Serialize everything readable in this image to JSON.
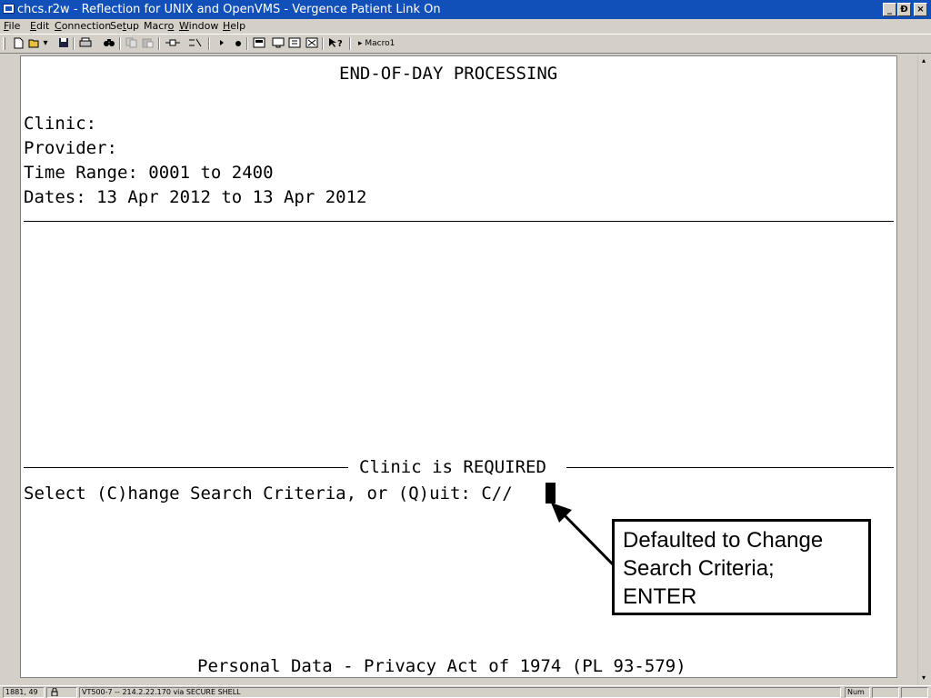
{
  "window": {
    "title": "chcs.r2w - Reflection for UNIX and OpenVMS - Vergence Patient Link On",
    "minimize": "_",
    "restore": "Ɖ",
    "close": "×"
  },
  "menu": [
    {
      "prefix": "",
      "ul": "F",
      "suffix": "ile"
    },
    {
      "prefix": "",
      "ul": "E",
      "suffix": "dit"
    },
    {
      "prefix": "",
      "ul": "C",
      "suffix": "onnection"
    },
    {
      "prefix": "Se",
      "ul": "t",
      "suffix": "up"
    },
    {
      "prefix": "Macr",
      "ul": "o",
      "suffix": ""
    },
    {
      "prefix": "",
      "ul": "W",
      "suffix": "indow"
    },
    {
      "prefix": "",
      "ul": "H",
      "suffix": "elp"
    }
  ],
  "toolbar": {
    "icons": [
      "new-icon",
      "open-icon",
      "save-icon",
      "print-icon",
      "find-icon",
      "copy-icon",
      "paste-icon",
      "connect-icon",
      "disconnect-icon",
      "play-icon",
      "record-icon",
      "macro1-icon",
      "macro2-icon",
      "macro3-icon",
      "macro4-icon",
      "help-icon"
    ],
    "macro_label": "Macro1"
  },
  "terminal": {
    "heading": "END-OF-DAY PROCESSING",
    "fields": [
      "Clinic:",
      "Provider:",
      "Time Range: 0001 to 2400",
      "Dates: 13 Apr 2012 to 13 Apr 2012"
    ],
    "message": "Clinic is REQUIRED",
    "prompt": "Select (C)hange Search Criteria, or (Q)uit: C//",
    "footer": "Personal Data - Privacy Act of 1974 (PL 93-579)"
  },
  "callout": {
    "lines": [
      "Defaulted to Change",
      "Search Criteria;",
      "ENTER"
    ]
  },
  "status": {
    "position": "1881, 49",
    "connection": "VT500-7 -- 214.2.22.170 via SECURE SHELL",
    "num": "Num"
  }
}
